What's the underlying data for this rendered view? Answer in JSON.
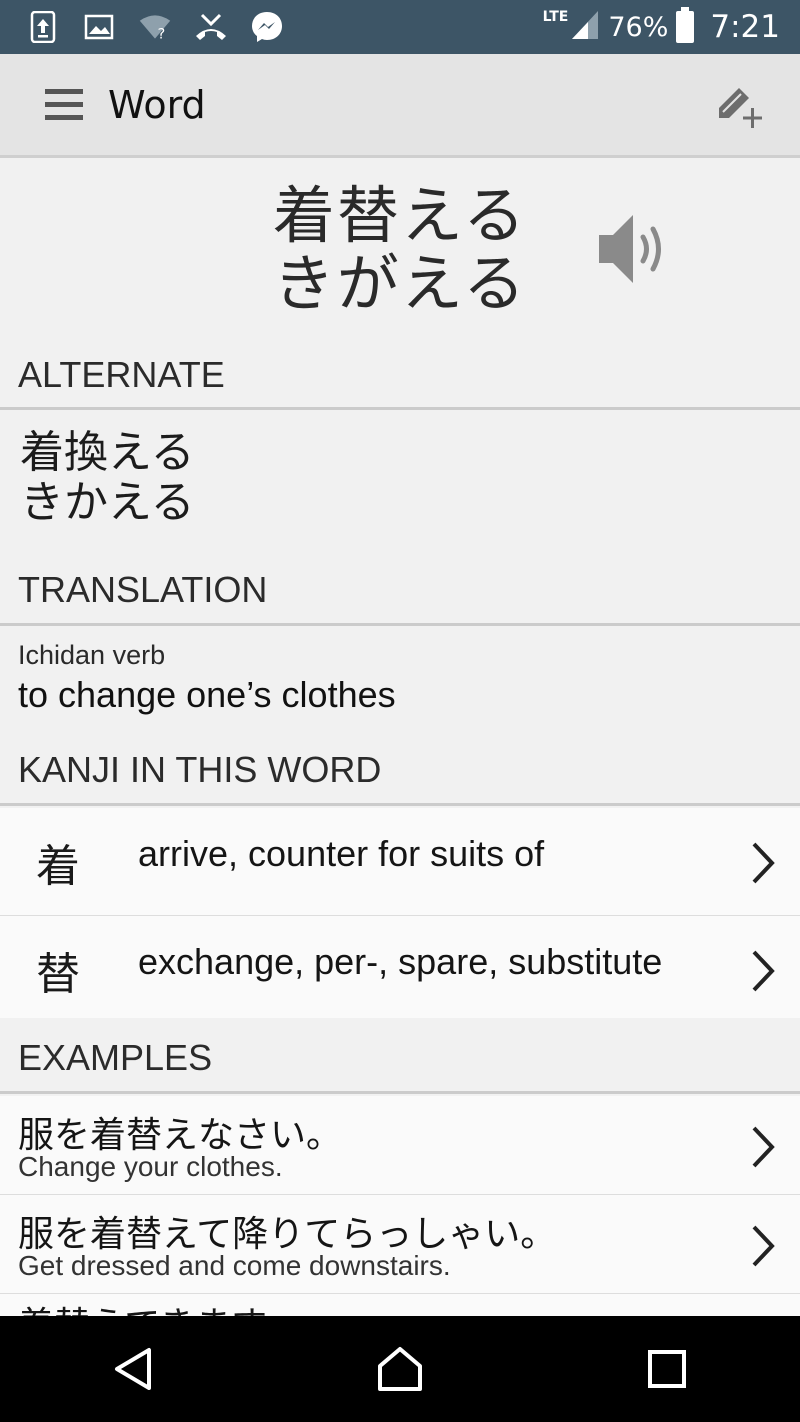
{
  "status_bar": {
    "network": "LTE",
    "battery": "76%",
    "time": "7:21"
  },
  "app_bar": {
    "title": "Word"
  },
  "word": {
    "kanji": "着替える",
    "reading": "きがえる"
  },
  "sections": {
    "alternate": "ALTERNATE",
    "translation": "TRANSLATION",
    "kanji": "KANJI IN THIS WORD",
    "examples": "EXAMPLES"
  },
  "alternate": {
    "kanji": "着換える",
    "reading": "きかえる"
  },
  "translation": {
    "pos": "Ichidan verb",
    "definition": "to change one’s clothes"
  },
  "kanji_list": [
    {
      "char": "着",
      "meaning": "arrive, counter for suits of"
    },
    {
      "char": "替",
      "meaning": "exchange, per-, spare, substitute"
    }
  ],
  "examples": [
    {
      "jp": "服を着替えなさい。",
      "en": "Change your clothes."
    },
    {
      "jp": "服を着替えて降りてらっしゃい。",
      "en": "Get dressed and come downstairs."
    },
    {
      "jp": "着替えてきます。",
      "en": ""
    }
  ],
  "colors": {
    "status_bar": "#3d5566",
    "app_bar": "#e4e4e4",
    "background": "#f1f1f1"
  }
}
